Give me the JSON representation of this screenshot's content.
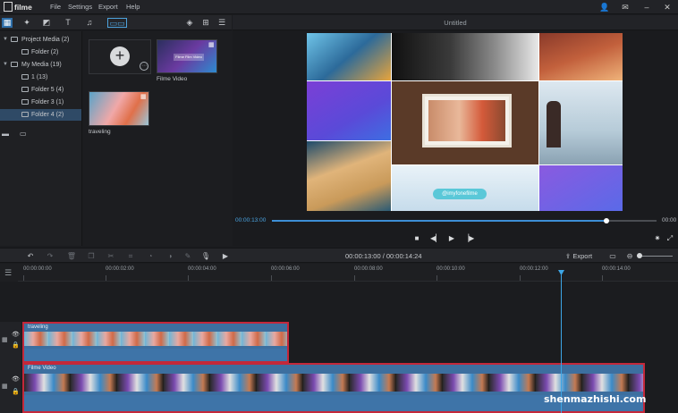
{
  "app": {
    "name": "filme",
    "menu": [
      "File",
      "Settings",
      "Export",
      "Help"
    ]
  },
  "preview": {
    "title": "Untitled",
    "current_time": "00:00:13:00",
    "end_time": "00:00",
    "progress_fraction": 0.87,
    "center_tag": "@imyfonefilme"
  },
  "tree": [
    {
      "label": "Project Media (2)",
      "expanded": true,
      "selected": false
    },
    {
      "label": "Folder (2)",
      "selected": false
    },
    {
      "label": "My Media (19)",
      "expanded": true,
      "selected": false
    },
    {
      "label": "1 (13)",
      "selected": false
    },
    {
      "label": "Folder 5 (4)",
      "selected": false
    },
    {
      "label": "Folder 3 (1)",
      "selected": false
    },
    {
      "label": "Folder 4 (2)",
      "selected": true
    }
  ],
  "media": [
    {
      "label": "Filme Video",
      "inner_text": "Filme Film Video"
    },
    {
      "label": "traveling"
    }
  ],
  "timeline": {
    "time_display": "00:00:13:00 / 00:00:14:24",
    "export_label": "Export",
    "ruler": [
      "00:00:00:00",
      "00:00:02:00",
      "00:00:04:00",
      "00:00:06:00",
      "00:00:08:00",
      "00:00:10:00",
      "00:00:12:00",
      "00:00:14:00"
    ],
    "clips": [
      {
        "name": "traveling"
      },
      {
        "name": "Filme Video"
      }
    ]
  },
  "watermark": "shenmazhishi.com",
  "colors": {
    "accent": "#3d8fd6",
    "selection": "#2f4a66",
    "clip_border": "#c4283a",
    "clip_fill": "#3d6f9f"
  }
}
